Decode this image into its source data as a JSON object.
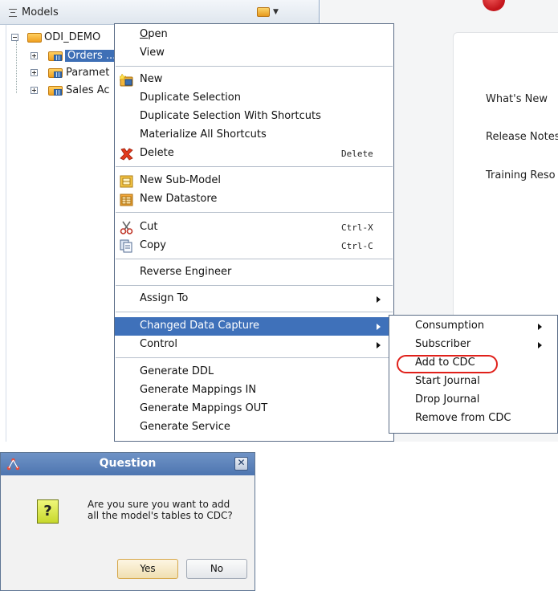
{
  "navigator": {
    "title": "Models",
    "tree": {
      "root": "ODI_DEMO",
      "children": [
        "Orders ...",
        "Paramet",
        "Sales Ac"
      ]
    }
  },
  "welcome": {
    "links": [
      "What's New",
      "Release Notes",
      "Training Reso"
    ]
  },
  "context_menu": {
    "open": "Open",
    "view": "View",
    "new": "New",
    "duplicate_selection": "Duplicate Selection",
    "duplicate_with_shortcuts": "Duplicate Selection With Shortcuts",
    "materialize_shortcuts": "Materialize All Shortcuts",
    "delete": "Delete",
    "delete_shortcut": "Delete",
    "new_submodel": "New Sub-Model",
    "new_datastore": "New Datastore",
    "cut": "Cut",
    "cut_shortcut": "Ctrl-X",
    "copy": "Copy",
    "copy_shortcut": "Ctrl-C",
    "reverse_engineer": "Reverse Engineer",
    "assign_to": "Assign To",
    "changed_data_capture": "Changed Data Capture",
    "control": "Control",
    "generate_ddl": "Generate DDL",
    "generate_mappings_in": "Generate Mappings IN",
    "generate_mappings_out": "Generate Mappings OUT",
    "generate_service": "Generate Service"
  },
  "cdc_submenu": {
    "consumption": "Consumption",
    "subscriber": "Subscriber",
    "add_to_cdc": "Add to CDC",
    "start_journal": "Start Journal",
    "drop_journal": "Drop Journal",
    "remove_from_cdc": "Remove from CDC"
  },
  "dialog": {
    "title": "Question",
    "message": "Are you sure you want to add all the model's tables to CDC?",
    "yes": "Yes",
    "no": "No"
  },
  "colors": {
    "selection": "#3f71ba",
    "annotation": "#e0201a",
    "dialog_title": "#5b80b8"
  }
}
